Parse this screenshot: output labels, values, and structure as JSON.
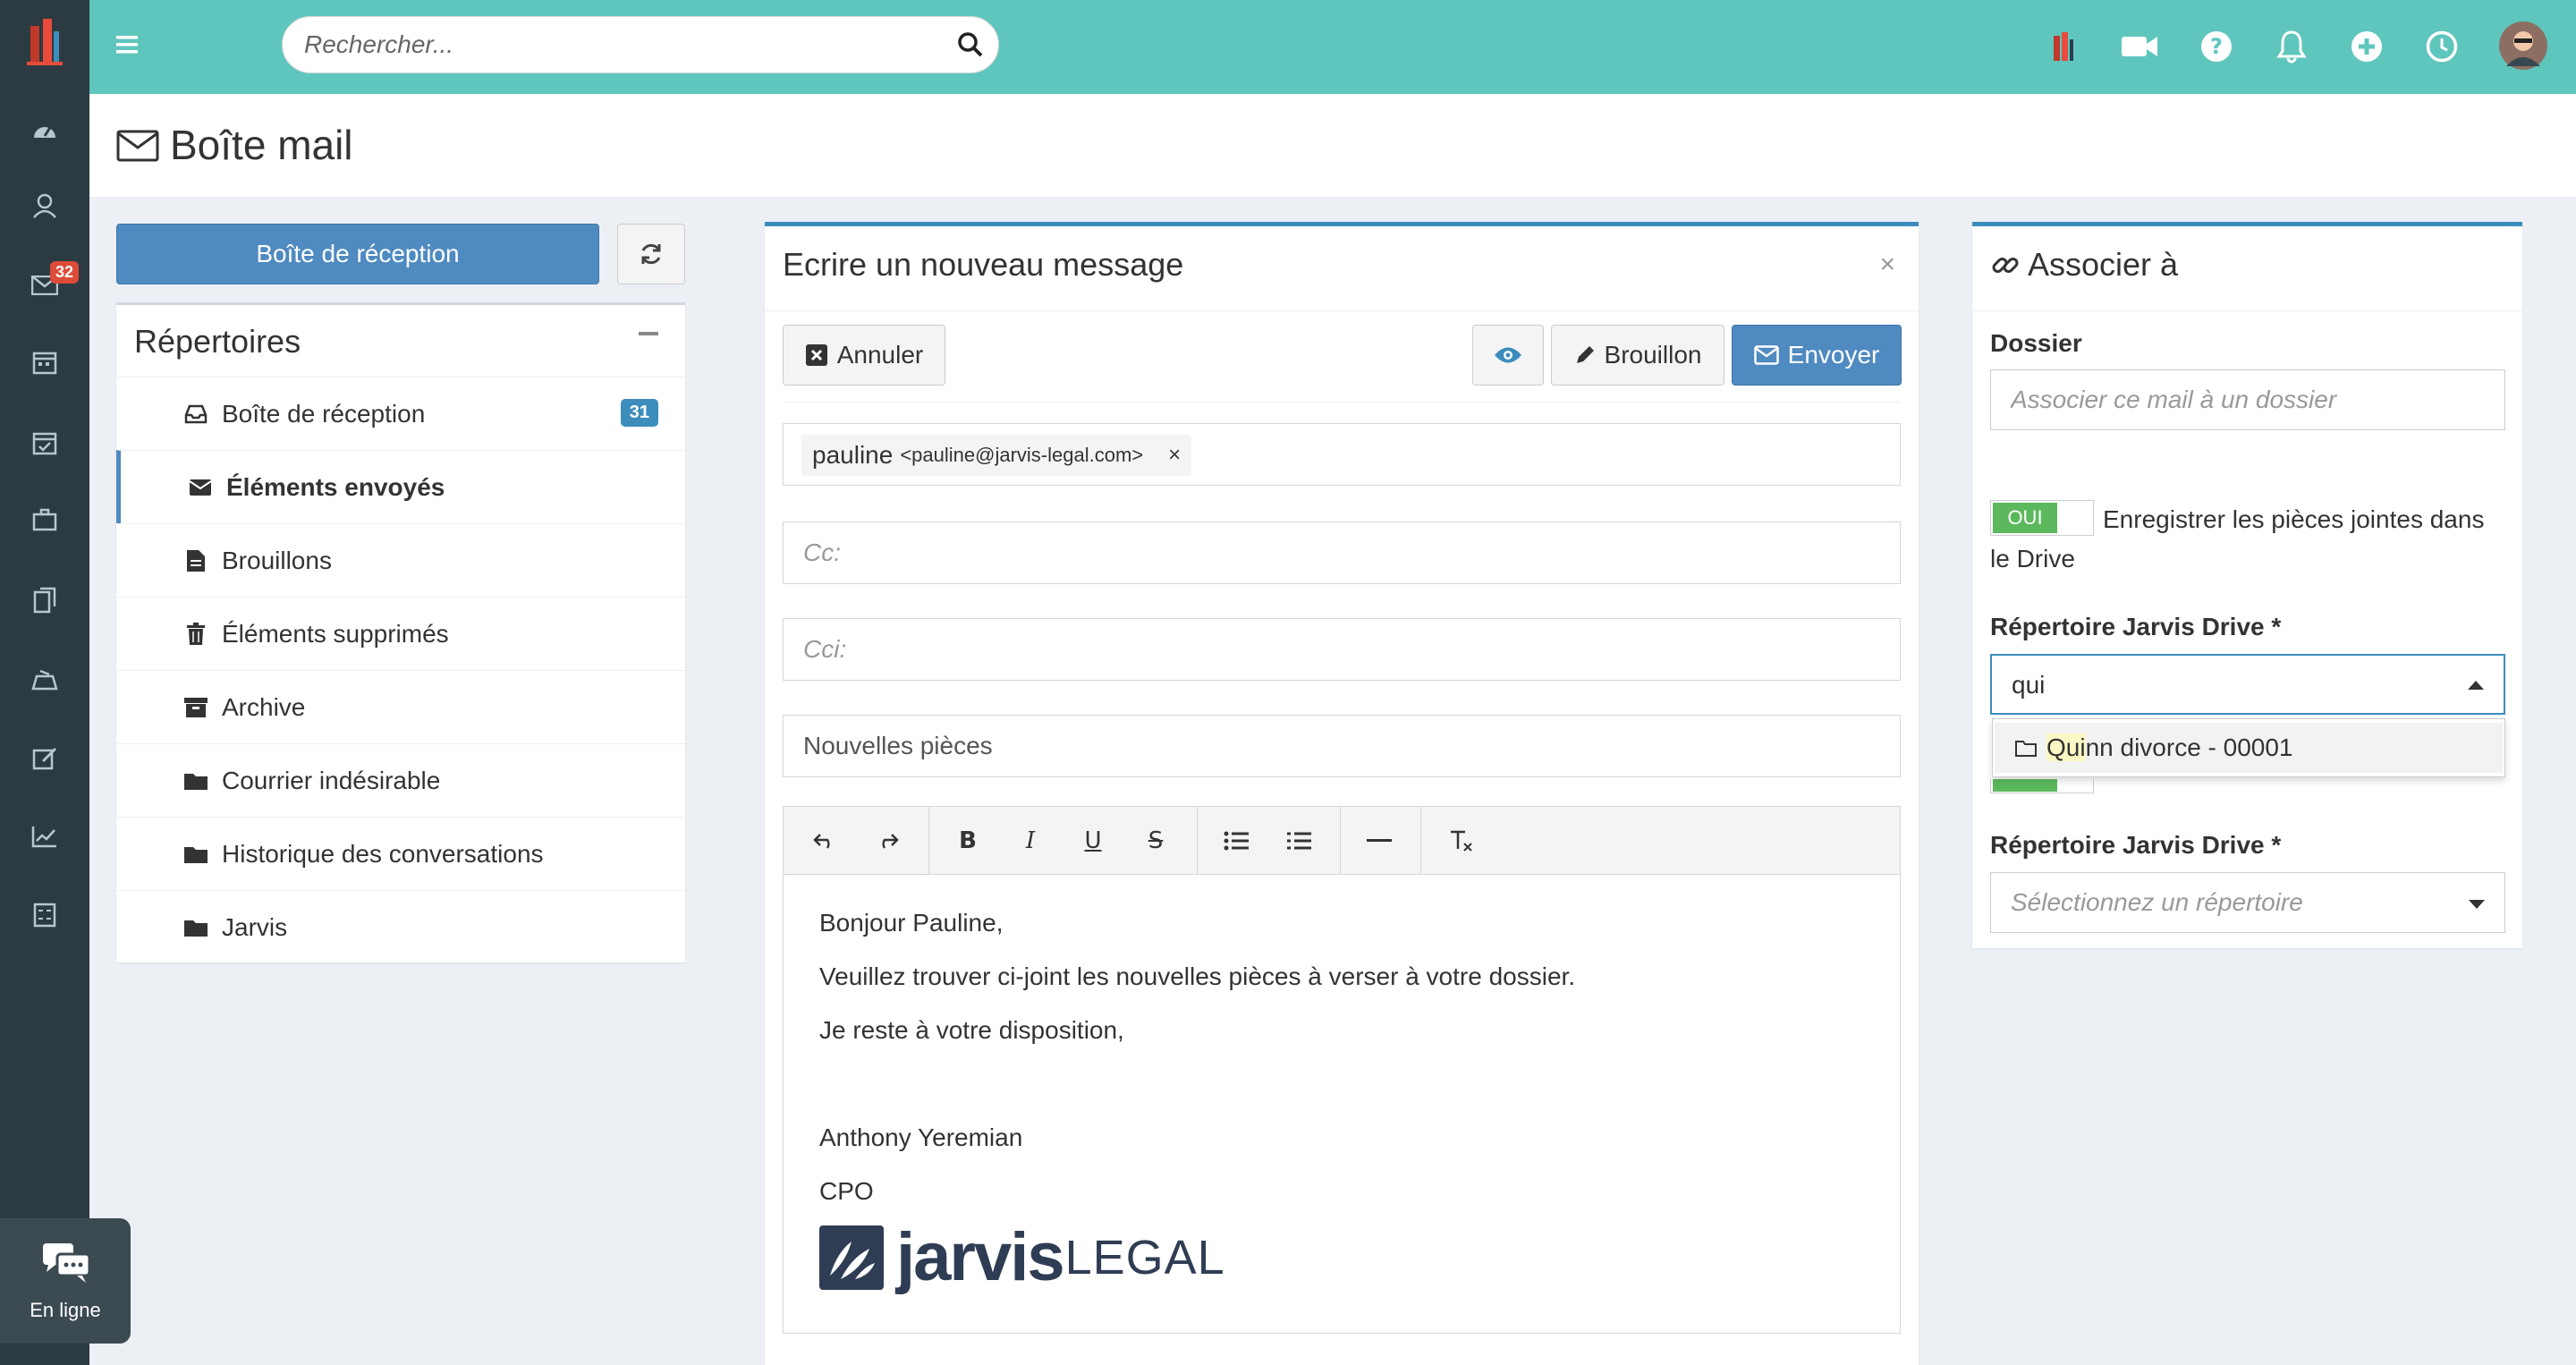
{
  "header": {
    "search_placeholder": "Rechercher..."
  },
  "sidebar": {
    "mail_badge": "32",
    "chat_label": "En ligne"
  },
  "page": {
    "title": "Boîte mail"
  },
  "left_panel": {
    "inbox_button": "Boîte de réception",
    "folders_title": "Répertoires",
    "folders": [
      {
        "label": "Boîte de réception",
        "badge": "31"
      },
      {
        "label": "Éléments envoyés"
      },
      {
        "label": "Brouillons"
      },
      {
        "label": "Éléments supprimés"
      },
      {
        "label": "Archive"
      },
      {
        "label": "Courrier indésirable"
      },
      {
        "label": "Historique des conversations"
      },
      {
        "label": "Jarvis"
      }
    ]
  },
  "compose": {
    "title": "Ecrire un nouveau message",
    "close": "×",
    "cancel_label": "Annuler",
    "draft_label": "Brouillon",
    "send_label": "Envoyer",
    "to_chip_name": "pauline",
    "to_chip_email": "<pauline@jarvis-legal.com>",
    "to_chip_remove": "×",
    "cc_placeholder": "Cc:",
    "bcc_placeholder": "Cci:",
    "subject_value": "Nouvelles pièces",
    "body_lines": [
      "Bonjour Pauline,",
      "Veuillez trouver ci-joint les nouvelles pièces à verser à votre dossier.",
      "Je reste à votre disposition,",
      "",
      "Anthony Yeremian",
      "CPO"
    ],
    "signature_logo_bold": "jarvis",
    "signature_logo_light": "LEGAL"
  },
  "associate": {
    "title": "Associer à",
    "dossier_label": "Dossier",
    "dossier_placeholder": "Associer ce mail à un dossier",
    "toggle_on": "OUI",
    "toggle_label": "Enregistrer les pièces jointes dans le Drive",
    "drive_label_1": "Répertoire Jarvis Drive *",
    "drive_search_value": "qui",
    "dropdown_option_match": "Qui",
    "dropdown_option_rest": "nn divorce - 00001",
    "drive_label_2": "Répertoire Jarvis Drive *",
    "drive_select_placeholder": "Sélectionnez un répertoire"
  }
}
